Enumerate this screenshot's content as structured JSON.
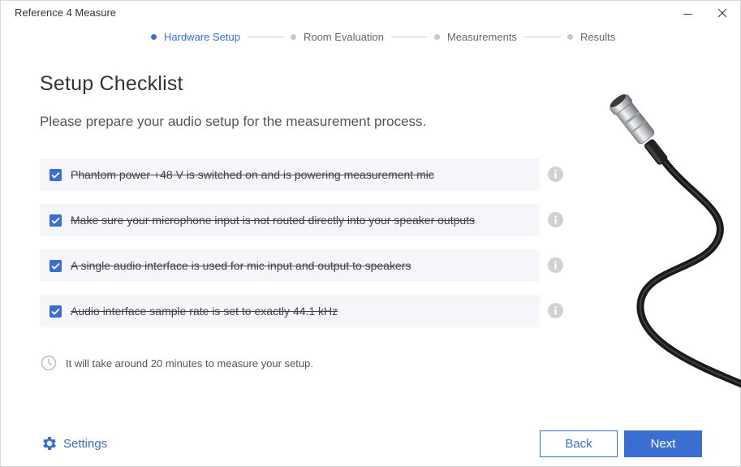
{
  "window": {
    "title": "Reference 4 Measure",
    "minimize_icon": "minimize-icon",
    "close_icon": "close-icon"
  },
  "stepper": {
    "steps": [
      {
        "label": "Hardware Setup",
        "active": true
      },
      {
        "label": "Room Evaluation",
        "active": false
      },
      {
        "label": "Measurements",
        "active": false
      },
      {
        "label": "Results",
        "active": false
      }
    ]
  },
  "main": {
    "title": "Setup Checklist",
    "subtitle": "Please prepare your audio setup for the measurement process.",
    "checklist": [
      {
        "label": "Phantom power +48 V is switched on and is powering measurement mic",
        "checked": true
      },
      {
        "label": "Make sure your microphone input is not routed directly into your speaker outputs",
        "checked": true
      },
      {
        "label": "A single audio interface is used for mic input and output to speakers",
        "checked": true
      },
      {
        "label": "Audio interface sample rate is set to exactly 44.1 kHz",
        "checked": true
      }
    ],
    "time_note": "It will take around 20 minutes to measure your setup."
  },
  "footer": {
    "settings_label": "Settings",
    "back_label": "Back",
    "next_label": "Next"
  },
  "colors": {
    "accent": "#3a6fd1",
    "row_background": "#f4f6fa",
    "info_icon": "#cfd1d4"
  },
  "icons": {
    "check": "checkmark-icon",
    "info": "info-icon",
    "clock": "clock-icon",
    "settings": "gear-icon",
    "illustration": "xlr-cable-illustration"
  }
}
